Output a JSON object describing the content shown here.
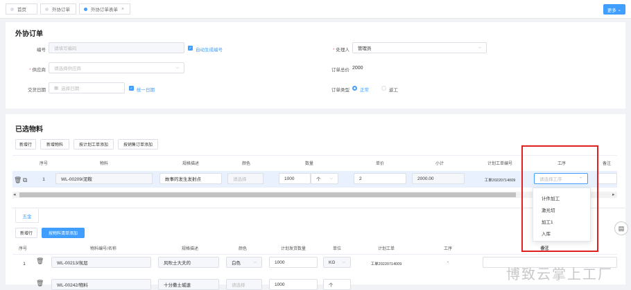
{
  "tabs": [
    {
      "label": "首页"
    },
    {
      "label": "外协订单"
    },
    {
      "label": "外协订单表单"
    }
  ],
  "more_label": "更多",
  "form": {
    "title": "外协订单",
    "code_label": "编号",
    "code_placeholder": "请填写编码",
    "auto_code_label": "自动生成编号",
    "handler_label": "处理人",
    "handler_value": "管理员",
    "supplier_label": "供应商",
    "supplier_placeholder": "请选择供应商",
    "total_label": "订单总价",
    "total_value": "2000",
    "delivery_label": "交货日期",
    "delivery_placeholder": "选择日期",
    "unify_date_label": "统一日期",
    "type_label": "订单类型",
    "type_options": [
      "正常",
      "返工"
    ]
  },
  "materials": {
    "title": "已选物料",
    "buttons": [
      "新增行",
      "新增物料",
      "按计划工单添加",
      "按销售订单添加"
    ],
    "headers": [
      "序号",
      "物料",
      "规格描述",
      "颜色",
      "数量",
      "单价",
      "小计",
      "计划工单编号",
      "工序",
      "备注"
    ],
    "row": {
      "index": "1",
      "material": "WL-00209/泥鞍",
      "spec": "故事的发生发射点",
      "color_placeholder": "请选择",
      "qty": "1000",
      "unit": "个",
      "price": "2",
      "subtotal": "2000.00",
      "plan_order": "工单20220714009",
      "process_placeholder": "请选择工序"
    },
    "process_options": [
      "计件加工",
      "激光切",
      "加工1",
      "入库"
    ]
  },
  "lower": {
    "tab_label": "五金",
    "buttons": [
      "新增行",
      "按物料清单添加"
    ],
    "headers": [
      "序号",
      "物料编号/名称",
      "规格描述",
      "颜色",
      "计划发货数量",
      "单位",
      "计划工单",
      "工序",
      "备注"
    ],
    "rows": [
      {
        "index": "1",
        "material": "WL-00213/氛层",
        "spec": "风吹士大夫的",
        "color": "白色",
        "qty": "1000",
        "unit": "KG",
        "plan_order": "工单20220714009",
        "process": "-"
      },
      {
        "index": "2",
        "material": "WL-00242/物料",
        "spec": "十分撒士城速",
        "color": "请选择",
        "qty": "1000",
        "unit": "个",
        "plan_order": "",
        "process": ""
      }
    ]
  },
  "watermark": "博致云掌上工厂"
}
